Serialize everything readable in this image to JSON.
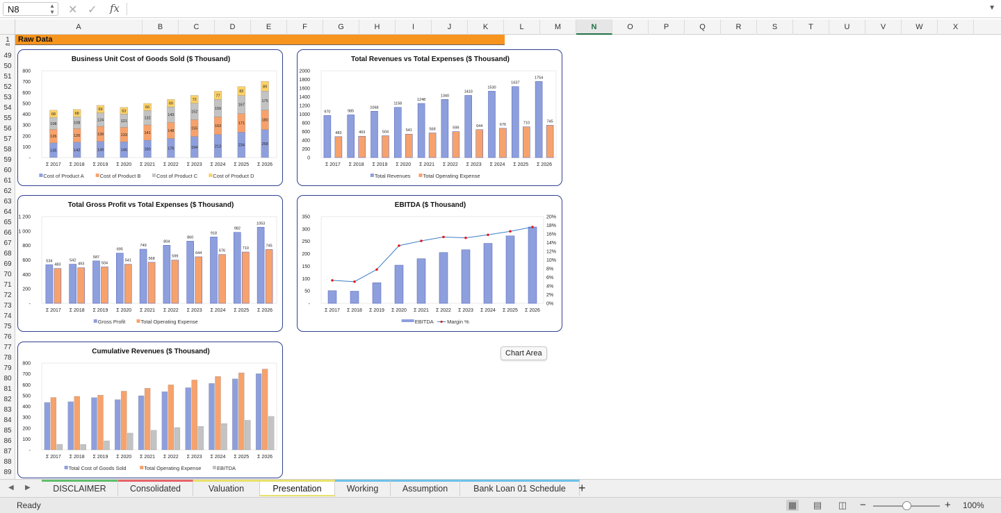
{
  "formula_bar": {
    "name_box": "N8",
    "cancel_icon": "cancel-icon",
    "enter_icon": "check-icon",
    "fx_label": "fx"
  },
  "columns": [
    "A",
    "B",
    "C",
    "D",
    "E",
    "F",
    "G",
    "H",
    "I",
    "J",
    "K",
    "L",
    "M",
    "N",
    "O",
    "P",
    "Q",
    "R",
    "S",
    "T",
    "U",
    "V",
    "W",
    "X"
  ],
  "selected_column": "N",
  "rows": [
    "1",
    "48",
    "49",
    "50",
    "51",
    "52",
    "53",
    "54",
    "55",
    "56",
    "57",
    "58",
    "59",
    "60",
    "61",
    "62",
    "63",
    "64",
    "65",
    "66",
    "67",
    "68",
    "69",
    "70",
    "71",
    "72",
    "73",
    "74",
    "75",
    "76",
    "77",
    "78",
    "79",
    "80",
    "81",
    "82",
    "83",
    "84",
    "85",
    "86",
    "87",
    "88",
    "89"
  ],
  "raw_banner": "Raw Data",
  "tooltip": "Chart Area",
  "colors": {
    "blue": "#8e9fdd",
    "orange": "#f7a26c",
    "gray": "#c3c3c3",
    "yellow": "#fcd168",
    "line": "#3b7fc4",
    "marker": "#e31a1c",
    "border": "#2e3f8f",
    "banner": "#f7941d"
  },
  "charts": {
    "cogs": {
      "title": "Business Unit Cost of Goods Sold ($ Thousand)",
      "type": "bar",
      "stacked": true,
      "categories": [
        "Σ 2017",
        "Σ 2018",
        "Σ 2019",
        "Σ 2020",
        "Σ 2021",
        "Σ 2022",
        "Σ 2023",
        "Σ 2024",
        "Σ 2025",
        "Σ 2026"
      ],
      "y_ticks": [
        "-",
        "100",
        "200",
        "300",
        "400",
        "500",
        "600",
        "700",
        "800"
      ],
      "ylim": [
        0,
        800
      ],
      "series": [
        {
          "name": "Cost of Product A",
          "values": [
            135,
            142,
            149,
            146,
            160,
            176,
            194,
            213,
            234,
            258
          ]
        },
        {
          "name": "Cost of Product B",
          "values": [
            126,
            126,
            139,
            133,
            141,
            148,
            155,
            163,
            171,
            180
          ]
        },
        {
          "name": "Cost of Product C",
          "values": [
            108,
            108,
            124,
            121,
            132,
            143,
            152,
            159,
            167,
            175
          ]
        },
        {
          "name": "Cost of Product D",
          "values": [
            68,
            68,
            69,
            63,
            66,
            69,
            72,
            77,
            82,
            89
          ]
        }
      ]
    },
    "revenue_expense": {
      "title": "Total Revenues vs Total Expenses ($ Thousand)",
      "type": "bar",
      "categories": [
        "Σ 2017",
        "Σ 2018",
        "Σ 2019",
        "Σ 2020",
        "Σ 2021",
        "Σ 2022",
        "Σ 2023",
        "Σ 2024",
        "Σ 2025",
        "Σ 2026"
      ],
      "y_ticks": [
        "0",
        "200",
        "400",
        "600",
        "800",
        "1000",
        "1200",
        "1400",
        "1600",
        "1800",
        "2000"
      ],
      "ylim": [
        0,
        2000
      ],
      "series": [
        {
          "name": "Total Revenues",
          "values": [
            970,
            985,
            1068,
            1158,
            1248,
            1340,
            1433,
            1530,
            1637,
            1754
          ]
        },
        {
          "name": "Total Operating Expense",
          "values": [
            483,
            493,
            504,
            541,
            568,
            599,
            644,
            676,
            710,
            745
          ]
        }
      ]
    },
    "gross_profit": {
      "title": "Total Gross Profit vs Total Expenses ($ Thousand)",
      "type": "bar",
      "categories": [
        "Σ 2017",
        "Σ 2018",
        "Σ 2019",
        "Σ 2020",
        "Σ 2021",
        "Σ 2022",
        "Σ 2023",
        "Σ 2024",
        "Σ 2025",
        "Σ 2026"
      ],
      "y_ticks": [
        "-",
        "200",
        "400",
        "600",
        "800",
        "1 000",
        "1 200"
      ],
      "ylim": [
        0,
        1200
      ],
      "series": [
        {
          "name": "Gross Profit",
          "values": [
            534,
            542,
            587,
            695,
            749,
            804,
            860,
            918,
            982,
            1053
          ]
        },
        {
          "name": "Total Operating Expense",
          "values": [
            483,
            493,
            504,
            541,
            568,
            599,
            644,
            676,
            710,
            745
          ]
        }
      ]
    },
    "ebitda": {
      "title": "EBITDA ($ Thousand)",
      "type": "bar+line",
      "categories": [
        "Σ 2017",
        "Σ 2018",
        "Σ 2019",
        "Σ 2020",
        "Σ 2021",
        "Σ 2022",
        "Σ 2023",
        "Σ 2024",
        "Σ 2025",
        "Σ 2026"
      ],
      "y_ticks": [
        "-",
        "50",
        "100",
        "150",
        "200",
        "250",
        "300",
        "350"
      ],
      "ylim": [
        0,
        350
      ],
      "y2_ticks": [
        "0%",
        "2%",
        "4%",
        "6%",
        "8%",
        "10%",
        "12%",
        "14%",
        "16%",
        "18%",
        "20%"
      ],
      "y2lim": [
        0,
        20
      ],
      "series": [
        {
          "name": "EBITDA",
          "values": [
            51,
            49,
            83,
            154,
            180,
            205,
            216,
            242,
            272,
            308
          ]
        },
        {
          "name": "Margin %",
          "values": [
            5.3,
            5.0,
            7.8,
            13.3,
            14.4,
            15.3,
            15.1,
            15.8,
            16.6,
            17.6
          ]
        }
      ]
    },
    "cumulative": {
      "title": "Cumulative Revenues ($ Thousand)",
      "type": "bar",
      "categories": [
        "Σ 2017",
        "Σ 2018",
        "Σ 2019",
        "Σ 2020",
        "Σ 2021",
        "Σ 2022",
        "Σ 2023",
        "Σ 2024",
        "Σ 2025",
        "Σ 2026"
      ],
      "y_ticks": [
        "-",
        "100",
        "200",
        "300",
        "400",
        "500",
        "600",
        "700",
        "800"
      ],
      "ylim": [
        0,
        800
      ],
      "series": [
        {
          "name": "Total Cost of Goods Sold",
          "values": [
            437,
            444,
            481,
            463,
            499,
            536,
            573,
            612,
            654,
            702
          ]
        },
        {
          "name": "Total Operating Expense",
          "values": [
            483,
            493,
            504,
            541,
            568,
            599,
            644,
            676,
            710,
            745
          ]
        },
        {
          "name": "EBITDA",
          "values": [
            51,
            49,
            83,
            154,
            180,
            205,
            216,
            242,
            272,
            308
          ]
        }
      ]
    }
  },
  "sheet_tabs": [
    {
      "label": "DISCLAIMER",
      "color": "#5fbf6a"
    },
    {
      "label": "Consolidated",
      "color": "#e8636b"
    },
    {
      "label": "Valuation",
      "color": "#e9e16b"
    },
    {
      "label": "Presentation",
      "color": "#e9e16b",
      "active": true
    },
    {
      "label": "Working",
      "color": "#6fc1e8"
    },
    {
      "label": "Assumption",
      "color": "#6fc1e8"
    },
    {
      "label": "Bank Loan 01 Schedule",
      "color": "#6fc1e8"
    }
  ],
  "add_sheet": "+",
  "status": {
    "ready": "Ready",
    "zoom": "100%",
    "zoom_fraction": 0.5
  }
}
